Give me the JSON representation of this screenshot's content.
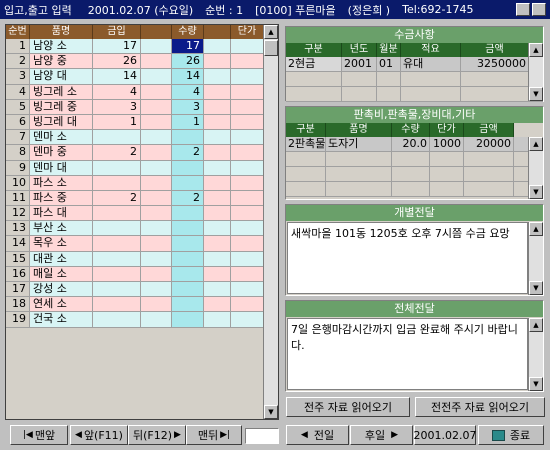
{
  "titlebar": {
    "title": "입고,출고 입력",
    "date": "2001.02.07 (수요일)",
    "order": "순번 : 1",
    "shop": "[0100] 푸른마을",
    "person": "(정은희 )",
    "tel": "Tel:692-1745"
  },
  "grid": {
    "headers": [
      "순번",
      "품명",
      "금입",
      "",
      "수량",
      "",
      "단가"
    ],
    "rows": [
      {
        "no": "1",
        "name": "남양 소",
        "in": "17",
        "qty": "17",
        "style": "blue",
        "selected": true
      },
      {
        "no": "2",
        "name": "남양 중",
        "in": "26",
        "qty": "26",
        "style": "pink"
      },
      {
        "no": "3",
        "name": "남양 대",
        "in": "14",
        "qty": "14",
        "style": "blue"
      },
      {
        "no": "4",
        "name": "빙그레 소",
        "in": "4",
        "qty": "4",
        "style": "pink"
      },
      {
        "no": "5",
        "name": "빙그레 중",
        "in": "3",
        "qty": "3",
        "style": "pink"
      },
      {
        "no": "6",
        "name": "빙그레 대",
        "in": "1",
        "qty": "1",
        "style": "pink"
      },
      {
        "no": "7",
        "name": "덴마 소",
        "in": "",
        "qty": "",
        "style": "blue"
      },
      {
        "no": "8",
        "name": "덴마 중",
        "in": "2",
        "qty": "2",
        "style": "pink"
      },
      {
        "no": "9",
        "name": "덴마 대",
        "in": "",
        "qty": "",
        "style": "blue"
      },
      {
        "no": "10",
        "name": "파스 소",
        "in": "",
        "qty": "",
        "style": "pink"
      },
      {
        "no": "11",
        "name": "파스 중",
        "in": "2",
        "qty": "2",
        "style": "pink"
      },
      {
        "no": "12",
        "name": "파스 대",
        "in": "",
        "qty": "",
        "style": "pink"
      },
      {
        "no": "13",
        "name": "부산 소",
        "in": "",
        "qty": "",
        "style": "blue"
      },
      {
        "no": "14",
        "name": "목우 소",
        "in": "",
        "qty": "",
        "style": "pink"
      },
      {
        "no": "15",
        "name": "대관 소",
        "in": "",
        "qty": "",
        "style": "blue"
      },
      {
        "no": "16",
        "name": "매일 소",
        "in": "",
        "qty": "",
        "style": "pink"
      },
      {
        "no": "17",
        "name": "강성 소",
        "in": "",
        "qty": "",
        "style": "blue"
      },
      {
        "no": "18",
        "name": "연세 소",
        "in": "",
        "qty": "",
        "style": "pink"
      },
      {
        "no": "19",
        "name": "건국 소",
        "in": "",
        "qty": "",
        "style": "blue"
      }
    ]
  },
  "nav": {
    "first": "맨앞",
    "prev": "앞(F11)",
    "next": "뒤(F12)",
    "last": "맨뒤"
  },
  "collection": {
    "title": "수금사항",
    "headers": [
      "구분",
      "년도",
      "월분",
      "적요",
      "금액"
    ],
    "rows": [
      {
        "type": "2현금",
        "year": "2001",
        "month": "01",
        "desc": "유대",
        "amount": "3250000"
      }
    ]
  },
  "sales": {
    "title": "판촉비,판촉물,장비대,기타",
    "headers": [
      "구분",
      "품명",
      "수량",
      "단가",
      "금액"
    ],
    "rows": [
      {
        "type": "2판촉물",
        "name": "도자기",
        "qty": "20.0",
        "price": "1000",
        "amount": "20000"
      }
    ]
  },
  "individual": {
    "title": "개별전달",
    "text": "새싹마을 101동 1205호 오후 7시쯤 수금 요망"
  },
  "broadcast": {
    "title": "전체전달",
    "text": "7일 은행마감시간까지 입금 완료해 주시기 바랍니다."
  },
  "buttons": {
    "read_prev_week": "전주 자료 읽어오기",
    "read_prev_prev_week": "전전주 자료 읽어오기",
    "prev_day": "전일",
    "next_day": "후일",
    "date": "2001.02.07",
    "close": "종료"
  },
  "colors": {
    "title_bg": "#0a1a6a",
    "grid_header": "#8b5a2b",
    "panel_title": "#6aa06a",
    "panel_header": "#2a6a2a",
    "row_pink": "#ffd8d8",
    "row_blue": "#d8f4f4",
    "qty_col": "#a8e8ec"
  }
}
